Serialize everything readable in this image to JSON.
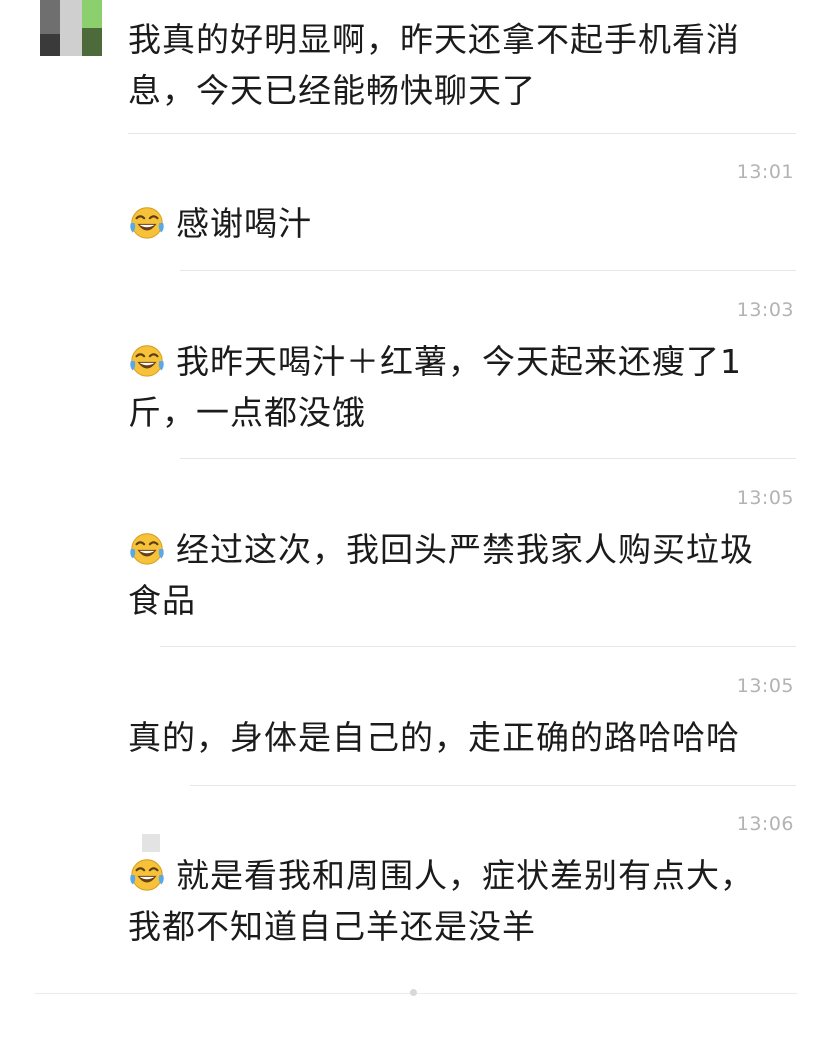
{
  "messages": [
    {
      "time": "",
      "emoji": false,
      "lines": [
        "我真的好明显啊，昨天还拿不起手机看消",
        "息，今天已经能畅快聊天了"
      ]
    },
    {
      "time": "13:01",
      "emoji": true,
      "lines": [
        "感谢喝汁"
      ]
    },
    {
      "time": "13:03",
      "emoji": true,
      "lines": [
        "我昨天喝汁＋红薯，今天起来还瘦了1",
        "斤，一点都没饿"
      ]
    },
    {
      "time": "13:05",
      "emoji": true,
      "lines": [
        "经过这次，我回头严禁我家人购买垃圾",
        "食品"
      ]
    },
    {
      "time": "13:05",
      "emoji": false,
      "lines": [
        "真的，身体是自己的，走正确的路哈哈哈"
      ]
    },
    {
      "time": "13:06",
      "emoji": true,
      "lines": [
        "就是看我和周围人，症状差别有点大，",
        "我都不知道自己羊还是没羊"
      ]
    }
  ],
  "icons": {
    "emoji": "laughing-tears-emoji-icon",
    "avatar": "pixelated-avatar"
  }
}
